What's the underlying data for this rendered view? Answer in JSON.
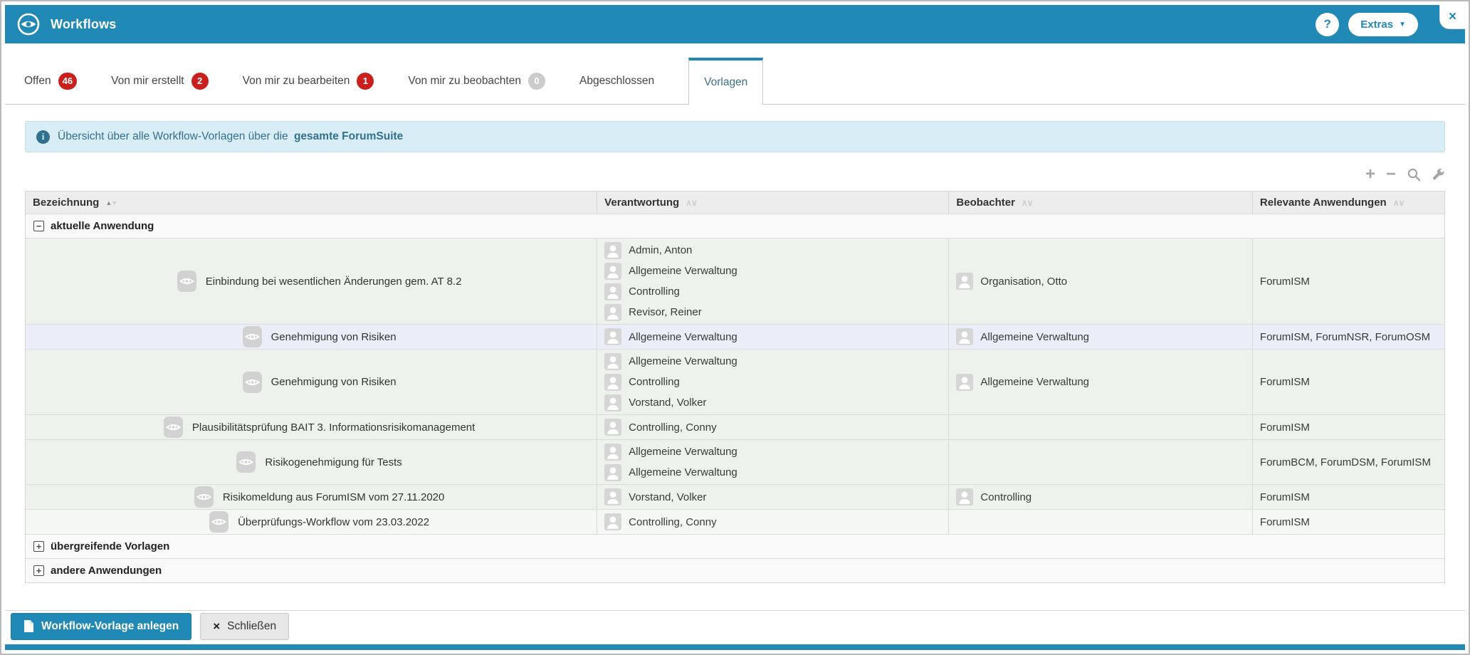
{
  "window": {
    "title": "Workflows"
  },
  "titlebar": {
    "help_label": "?",
    "extras_label": "Extras"
  },
  "tabs": [
    {
      "label": "Offen",
      "badge": "46",
      "badge_style": "red",
      "active": false
    },
    {
      "label": "Von mir erstellt",
      "badge": "2",
      "badge_style": "red",
      "active": false
    },
    {
      "label": "Von mir zu bearbeiten",
      "badge": "1",
      "badge_style": "red",
      "active": false
    },
    {
      "label": "Von mir zu beobachten",
      "badge": "0",
      "badge_style": "gray",
      "active": false
    },
    {
      "label": "Abgeschlossen",
      "active": false
    },
    {
      "label": "Vorlagen",
      "active": true
    }
  ],
  "info_bar": {
    "text": "Übersicht über alle Workflow-Vorlagen über die",
    "text_bold": "gesamte ForumSuite"
  },
  "toolbar": {
    "icons": [
      "plus-icon",
      "minus-icon",
      "search-icon",
      "wrench-icon"
    ]
  },
  "table": {
    "columns": [
      {
        "label": "Bezeichnung",
        "sorted": true
      },
      {
        "label": "Verantwortung",
        "sorted": false
      },
      {
        "label": "Beobachter",
        "sorted": false
      },
      {
        "label": "Relevante Anwendungen",
        "sorted": false
      }
    ],
    "groups": [
      {
        "label": "aktuelle Anwendung",
        "expanded": true,
        "rows": [
          {
            "name": "Einbindung bei wesentlichen Änderungen gem. AT 8.2",
            "responsible": [
              "Admin, Anton",
              "Allgemeine Verwaltung",
              "Controlling",
              "Revisor, Reiner"
            ],
            "observers": [
              "Organisation, Otto"
            ],
            "applications": "ForumISM",
            "tint": "green"
          },
          {
            "name": "Genehmigung von Risiken",
            "responsible": [
              "Allgemeine Verwaltung"
            ],
            "observers": [
              "Allgemeine Verwaltung"
            ],
            "applications": "ForumISM, ForumNSR, ForumOSM",
            "tint": "blue"
          },
          {
            "name": "Genehmigung von Risiken",
            "responsible": [
              "Allgemeine Verwaltung",
              "Controlling",
              "Vorstand, Volker"
            ],
            "observers": [
              "Allgemeine Verwaltung"
            ],
            "applications": "ForumISM",
            "tint": "green"
          },
          {
            "name": "Plausibilitätsprüfung BAIT 3. Informationsrisikomanagement",
            "responsible": [
              "Controlling, Conny"
            ],
            "observers": [],
            "applications": "ForumISM",
            "tint": "green"
          },
          {
            "name": "Risikogenehmigung für Tests",
            "responsible": [
              "Allgemeine Verwaltung",
              "Allgemeine Verwaltung"
            ],
            "observers": [],
            "applications": "ForumBCM, ForumDSM, ForumISM",
            "tint": "green"
          },
          {
            "name": "Risikomeldung aus ForumISM vom 27.11.2020",
            "responsible": [
              "Vorstand, Volker"
            ],
            "observers": [
              "Controlling"
            ],
            "applications": "ForumISM",
            "tint": "green"
          },
          {
            "name": "Überprüfungs-Workflow vom 23.03.2022",
            "responsible": [
              "Controlling, Conny"
            ],
            "observers": [],
            "applications": "ForumISM",
            "tint": "light"
          }
        ]
      },
      {
        "label": "übergreifende Vorlagen",
        "expanded": false,
        "rows": []
      },
      {
        "label": "andere Anwendungen",
        "expanded": false,
        "rows": []
      }
    ]
  },
  "footer": {
    "create_label": "Workflow-Vorlage anlegen",
    "close_label": "Schließen"
  },
  "colors": {
    "accent": "#2189b5",
    "badge_red": "#c9201d",
    "badge_gray": "#cbcbcb",
    "info_bg": "#d9edf7",
    "info_text": "#31708f",
    "row_green": "#edf2ec",
    "row_blue": "#ebedf8",
    "row_light": "#f4f7f3"
  }
}
